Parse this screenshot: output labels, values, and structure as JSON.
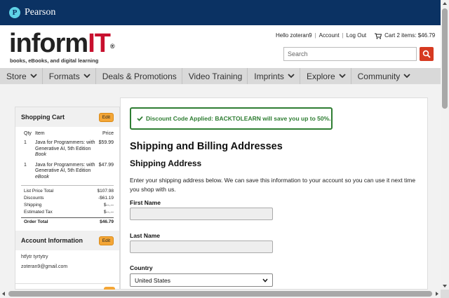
{
  "pearson": {
    "brand": "Pearson",
    "logo_letter": "P"
  },
  "header": {
    "logo_main": "inform",
    "logo_accent": "IT",
    "logo_reg": "®",
    "tagline": "books, eBooks, and digital learning",
    "greeting": "Hello zoteran9",
    "account_label": "Account",
    "logout_label": "Log Out",
    "cart_label": "Cart 2 items: $46.79",
    "separator": "|"
  },
  "search": {
    "placeholder": "Search"
  },
  "nav": {
    "items": [
      {
        "label": "Store"
      },
      {
        "label": "Formats"
      },
      {
        "label": "Deals & Promotions"
      },
      {
        "label": "Video Training"
      },
      {
        "label": "Imprints"
      },
      {
        "label": "Explore"
      },
      {
        "label": "Community"
      }
    ]
  },
  "cart": {
    "title": "Shopping Cart",
    "edit": "Edit",
    "col_qty": "Qty",
    "col_item": "Item",
    "col_price": "Price",
    "items": [
      {
        "qty": "1",
        "name": "Java for Programmers: with Generative AI, 5th Edition",
        "format": "Book",
        "price": "$59.99"
      },
      {
        "qty": "1",
        "name": "Java for Programmers: with Generative AI, 5th Edition",
        "format": "eBook",
        "price": "$47.99"
      }
    ],
    "totals": {
      "list_label": "List Price Total",
      "list_value": "$107.98",
      "disc_label": "Discounts",
      "disc_value": "-$61.19",
      "ship_label": "Shipping",
      "ship_value": "$--.--",
      "tax_label": "Estimated Tax",
      "tax_value": "$--.--",
      "order_label": "Order Total",
      "order_value": "$46.79"
    }
  },
  "account": {
    "title": "Account Information",
    "edit": "Edit",
    "name": "htfytr tyrtytry",
    "email": "zoteran9@gmail.com"
  },
  "main": {
    "alert": "Discount Code Applied: BACKTOLEARN will save you up to 50%.",
    "heading": "Shipping and Billing Addresses",
    "subheading": "Shipping Address",
    "intro": "Enter your shipping address below. We can save this information to your account so you can use it next time you shop with us.",
    "first_name_label": "First Name",
    "first_name_value": "",
    "last_name_label": "Last Name",
    "last_name_value": "",
    "country_label": "Country",
    "country_value": "United States"
  },
  "colors": {
    "pearson_blue": "#0b3263",
    "brand_red": "#c8102e",
    "search_button": "#d63a21",
    "edit_orange": "#f4a636",
    "success_green": "#2e7d32"
  }
}
